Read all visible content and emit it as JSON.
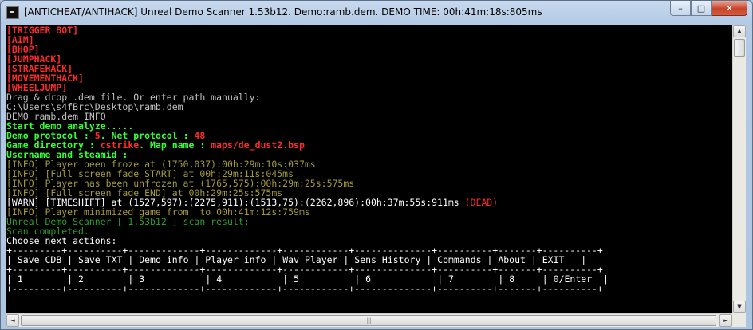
{
  "window": {
    "title": "[ANTICHEAT/ANTIHACK] Unreal Demo Scanner 1.53b12. Demo:ramb.dem. DEMO TIME: 00h:41m:18s:805ms",
    "buttons": {
      "minimize": "–",
      "maximize": "□",
      "close": "✕"
    }
  },
  "console": {
    "detections": [
      "[TRIGGER BOT]",
      "[AIM]",
      "[BHOP]",
      "[JUMPHACK]",
      "[STRAFEHACK]",
      "[MOVEMENTHACK]",
      "[WHEELJUMP]"
    ],
    "prompt": "Drag & drop .dem file. Or enter path manually:",
    "path": "C:\\Users\\s4fBrc\\Desktop\\ramb.dem",
    "demo_info": "DEMO ramb.dem INFO",
    "start": "Start demo analyze.....",
    "protocol": {
      "label1": "Demo protocol : ",
      "demo_protocol": "5",
      "label2": ". Net protocol : ",
      "net_protocol": "48"
    },
    "gamedir": {
      "label1": "Game directory : ",
      "dir": "cstrike",
      "label2": ". Map name : ",
      "map": "maps/de_dust2.bsp"
    },
    "username": "Username and steamid :",
    "info": [
      "[INFO] Player been froze at (1750,037):00h:29m:10s:037ms",
      "[INFO] [Full screen fade START] at 00h:29m:11s:045ms",
      "[INFO] Player has been unfrozen at (1765,575):00h:29m:25s:575ms",
      "[INFO] [Full screen fade END] at 00h:29m:25s:575ms"
    ],
    "warn": {
      "text": "[WARN] [TIMESHIFT] at (1527,597):(2275,911):(1513,75):(2262,896):00h:37m:55s:911ms",
      "dead": "(DEAD)"
    },
    "minimized": "[INFO] Player minimized game from  to 00h:41m:12s:759ms",
    "scan_result": "Unreal Demo Scanner [ 1.53b12 ] scan result:",
    "scan_completed": "Scan completed.",
    "choose": "Choose next actions:",
    "menu": {
      "border_top": "+---------+----------+-------------+-------------+------------+--------------+----------+-------+----------+",
      "border_mid": "+---------+----------+-------------+-------------+------------+--------------+----------+-------+----------+",
      "border_bottom": "+---------+----------+-------------+-------------+------------+--------------+----------+-------+----------+",
      "labels": [
        "Save CDB",
        "Save TXT",
        "Demo info",
        "Player info",
        "Wav Player",
        "Sens History",
        "Commands",
        "About",
        "EXIT"
      ],
      "keys": [
        "1",
        "2",
        "3",
        "4",
        "5",
        "6",
        "7",
        "8",
        "0/Enter"
      ]
    }
  },
  "scrollbars": {
    "up": "▲",
    "down": "▼",
    "left": "◄",
    "right": "►",
    "grip": "|||"
  }
}
